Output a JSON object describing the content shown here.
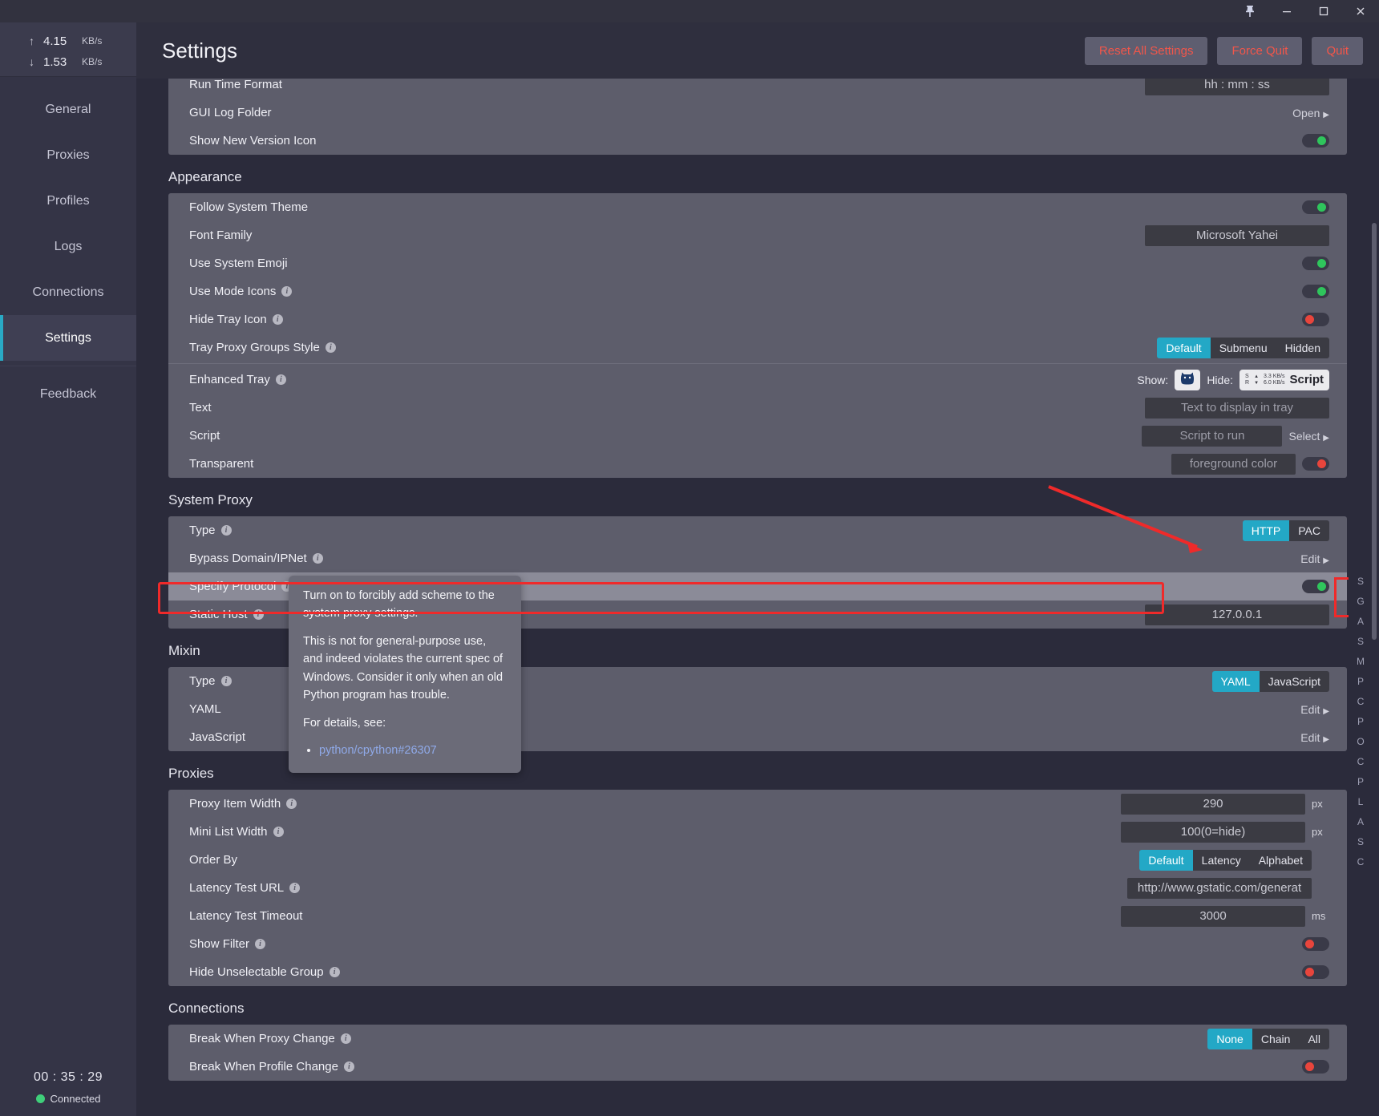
{
  "titlebar": {
    "pin": "pin-icon",
    "minimize": "–",
    "maximize": "▢",
    "close": "✕"
  },
  "sidebar": {
    "upload_arrow": "↑",
    "upload_speed": "4.15",
    "upload_unit": "KB/s",
    "download_arrow": "↓",
    "download_speed": "1.53",
    "download_unit": "KB/s",
    "items": [
      {
        "label": "General",
        "active": false
      },
      {
        "label": "Proxies",
        "active": false
      },
      {
        "label": "Profiles",
        "active": false
      },
      {
        "label": "Logs",
        "active": false
      },
      {
        "label": "Connections",
        "active": false
      },
      {
        "label": "Settings",
        "active": true
      },
      {
        "label": "Feedback",
        "active": false
      }
    ],
    "timer": "00 : 35 : 29",
    "status": "Connected"
  },
  "header": {
    "title": "Settings",
    "reset_label": "Reset All Settings",
    "force_quit_label": "Force Quit",
    "quit_label": "Quit"
  },
  "sections": {
    "top_partial": {
      "rows": [
        {
          "label": "Run Time Format",
          "value": "hh : mm : ss"
        },
        {
          "label": "GUI Log Folder",
          "link": "Open"
        },
        {
          "label": "Show New Version Icon",
          "toggle": "on"
        }
      ]
    },
    "appearance": {
      "title": "Appearance",
      "rows": [
        {
          "label": "Follow System Theme",
          "toggle": "on"
        },
        {
          "label": "Font Family",
          "value": "Microsoft Yahei"
        },
        {
          "label": "Use System Emoji",
          "toggle": "on"
        },
        {
          "label": "Use Mode Icons",
          "info": true,
          "toggle": "on"
        },
        {
          "label": "Hide Tray Icon",
          "info": true,
          "toggle": "off"
        },
        {
          "label": "Tray Proxy Groups Style",
          "info": true,
          "segments": [
            "Default",
            "Submenu",
            "Hidden"
          ],
          "selected": "Default"
        }
      ],
      "enhanced_tray": {
        "label": "Enhanced Tray",
        "info": true,
        "show_label": "Show:",
        "show_icon": "cat-icon",
        "hide_label": "Hide:",
        "hide_s": "S",
        "hide_r": "R",
        "hide_up_rate": "3.3 KB/s",
        "hide_down_rate": "6.0 KB/s",
        "hide_script": "Script"
      },
      "text_row": {
        "label": "Text",
        "placeholder": "Text to display in tray"
      },
      "script_row": {
        "label": "Script",
        "placeholder": "Script to run",
        "link": "Select"
      },
      "transparent_row": {
        "label": "Transparent",
        "placeholder": "foreground color",
        "swatch_color": "#e8453c"
      }
    },
    "system_proxy": {
      "title": "System Proxy",
      "type_row": {
        "label": "Type",
        "info": true,
        "segments": [
          "HTTP",
          "PAC"
        ],
        "selected": "HTTP"
      },
      "bypass_row": {
        "label": "Bypass Domain/IPNet",
        "info": true,
        "link": "Edit"
      },
      "specify_row": {
        "label": "Specify Protocol",
        "info": true,
        "toggle": "on"
      },
      "static_row": {
        "label": "Static Host",
        "info": true,
        "value": "127.0.0.1"
      }
    },
    "mixin": {
      "title": "Mixin",
      "type_row": {
        "label": "Type",
        "info": true,
        "segments": [
          "YAML",
          "JavaScript"
        ],
        "selected": "YAML"
      },
      "yaml_row": {
        "label": "YAML",
        "link": "Edit"
      },
      "js_row": {
        "label": "JavaScript",
        "link": "Edit"
      }
    },
    "proxies": {
      "title": "Proxies",
      "rows": [
        {
          "label": "Proxy Item Width",
          "info": true,
          "value": "290",
          "suffix": "px"
        },
        {
          "label": "Mini List Width",
          "info": true,
          "value": "100(0=hide)",
          "suffix": "px"
        },
        {
          "label": "Order By",
          "segments": [
            "Default",
            "Latency",
            "Alphabet"
          ],
          "selected": "Default"
        },
        {
          "label": "Latency Test URL",
          "info": true,
          "value": "http://www.gstatic.com/generat"
        },
        {
          "label": "Latency Test Timeout",
          "value": "3000",
          "suffix": "ms"
        },
        {
          "label": "Show Filter",
          "info": true,
          "toggle": "off"
        },
        {
          "label": "Hide Unselectable Group",
          "info": true,
          "toggle": "off"
        }
      ]
    },
    "connections": {
      "title": "Connections",
      "rows": [
        {
          "label": "Break When Proxy Change",
          "info": true,
          "segments": [
            "None",
            "Chain",
            "All"
          ],
          "selected": "None"
        },
        {
          "label": "Break When Profile Change",
          "info": true,
          "toggle": "off"
        }
      ]
    }
  },
  "tooltip": {
    "p1": "Turn on to forcibly add scheme to the system proxy settings.",
    "p2": "This is not for general-purpose use, and indeed violates the current spec of Windows. Consider it only when an old Python program has trouble.",
    "p3": "For details, see:",
    "link": "python/cpython#26307"
  },
  "letter_index": [
    "S",
    "G",
    "A",
    "S",
    "M",
    "P",
    "C",
    "P",
    "O",
    "C",
    "P",
    "L",
    "A",
    "S",
    "C"
  ],
  "colors": {
    "accent": "#23a8c6",
    "danger": "#f2564a",
    "toggle_on": "#2fc55c",
    "toggle_off": "#e8453c",
    "annotation": "#ef2a2a"
  }
}
